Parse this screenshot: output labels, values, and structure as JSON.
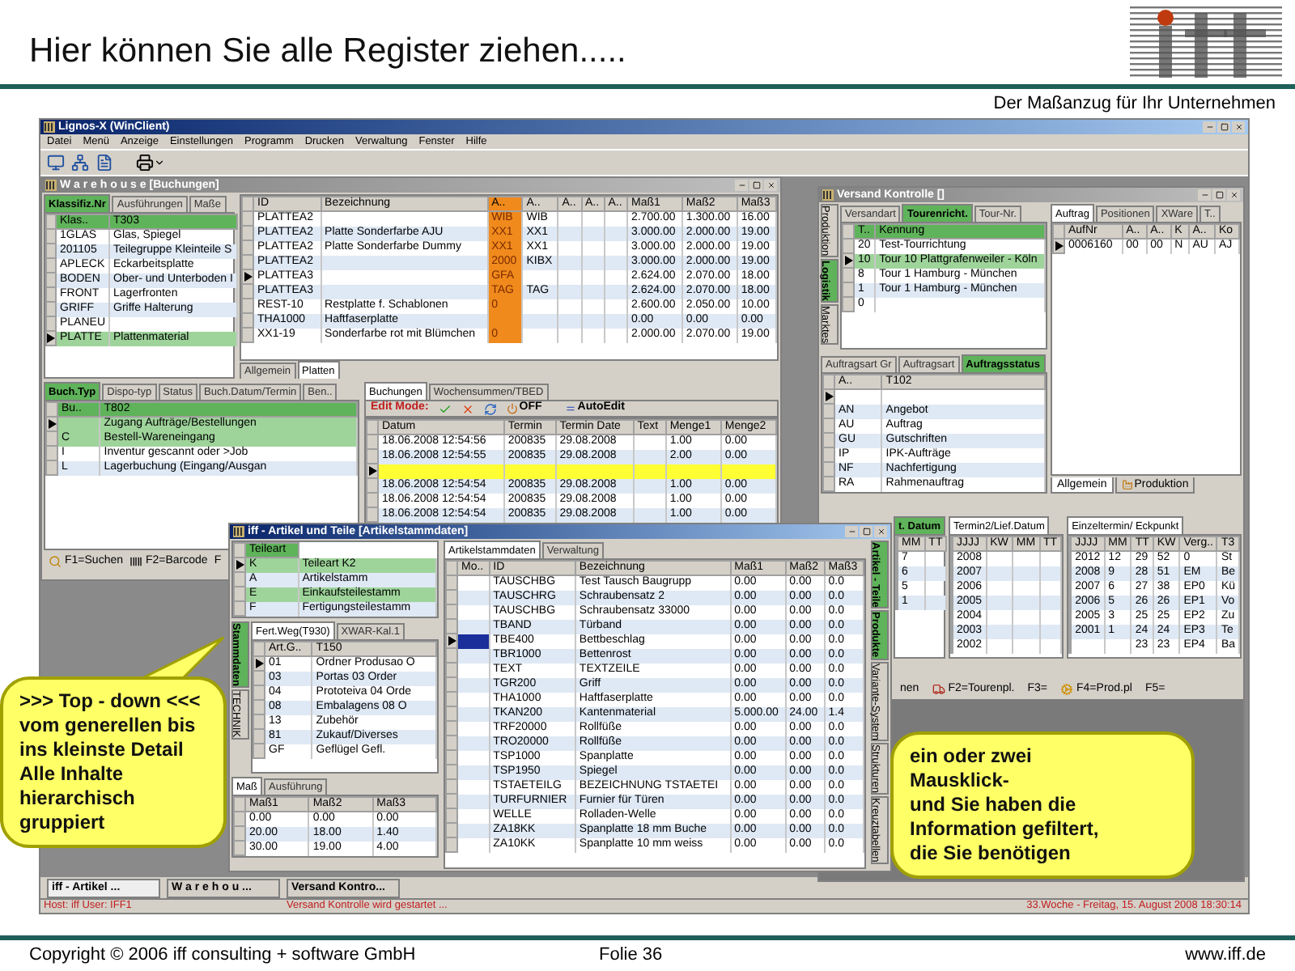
{
  "slide_title": "Hier können Sie alle Register ziehen.....",
  "tagline": "Der Maßanzug für Ihr Unternehmen",
  "app": {
    "title": "Lignos-X (WinClient)",
    "menu": [
      "Datei",
      "Menü",
      "Anzeige",
      "Einstellungen",
      "Programm",
      "Drucken",
      "Verwaltung",
      "Fenster",
      "Hilfe"
    ],
    "warehouse": {
      "title": "W a r e h o u s e [Buchungen]",
      "class_tabs": {
        "tabs": [
          {
            "label": "Klassifiz.Nr",
            "selected": true
          },
          {
            "label": "Ausführungen",
            "selected": false
          },
          {
            "label": "Maße",
            "selected": false
          }
        ]
      },
      "class_grid": {
        "header_green": true,
        "columns": [
          {
            "label": "Klas.."
          },
          {
            "label": "T303"
          }
        ],
        "rows": [
          {
            "cells": [
              "1GLAS",
              "Glas, Spiegel"
            ],
            "selected": false,
            "current": false
          },
          {
            "cells": [
              "201105",
              "Teilegruppe Kleinteile S"
            ],
            "selected": false,
            "current": false
          },
          {
            "cells": [
              "APLECK",
              "Eckarbeitsplatte"
            ],
            "selected": false,
            "current": false
          },
          {
            "cells": [
              "BODEN",
              "Ober- und Unterboden I"
            ],
            "selected": false,
            "current": false
          },
          {
            "cells": [
              "FRONT",
              "Lagerfronten"
            ],
            "selected": false,
            "current": false
          },
          {
            "cells": [
              "GRIFF",
              "Griffe Halterung"
            ],
            "selected": false,
            "current": false
          },
          {
            "cells": [
              "PLANEU",
              null
            ],
            "selected": false,
            "current": false
          },
          {
            "cells": [
              "PLATTE",
              "Plattenmaterial"
            ],
            "selected": true,
            "current": true
          }
        ]
      },
      "main_grid": {
        "header_green": false,
        "columns": [
          {
            "label": "ID",
            "accent": false
          },
          {
            "label": "Bezeichnung",
            "accent": false
          },
          {
            "label": "A..",
            "accent": true
          },
          {
            "label": "A..",
            "accent": false
          },
          {
            "label": "A..",
            "accent": false
          },
          {
            "label": "A..",
            "accent": false
          },
          {
            "label": "A..",
            "accent": false
          },
          {
            "label": "Maß1",
            "accent": false
          },
          {
            "label": "Maß2",
            "accent": false
          },
          {
            "label": "Maß3",
            "accent": false
          }
        ],
        "rows": [
          {
            "cells": [
              "PLATTEA2",
              null,
              "WIB",
              "WIB",
              null,
              null,
              null,
              "2.700.00",
              "1.300.00",
              "16.00"
            ],
            "selected": false,
            "current": false
          },
          {
            "cells": [
              "PLATTEA2",
              "Platte Sonderfarbe AJU",
              "XX1",
              "XX1",
              null,
              null,
              null,
              "3.000.00",
              "2.000.00",
              "19.00"
            ],
            "selected": false,
            "current": false
          },
          {
            "cells": [
              "PLATTEA2",
              "Platte Sonderfarbe Dummy",
              "XX1",
              "XX1",
              null,
              null,
              null,
              "3.000.00",
              "2.000.00",
              "19.00"
            ],
            "selected": false,
            "current": false
          },
          {
            "cells": [
              "PLATTEA2",
              null,
              "2000",
              "KIBX",
              null,
              null,
              null,
              "3.000.00",
              "2.000.00",
              "19.00"
            ],
            "selected": false,
            "current": false
          },
          {
            "cells": [
              "PLATTEA3",
              null,
              "GFA",
              null,
              null,
              null,
              null,
              "2.624.00",
              "2.070.00",
              "18.00"
            ],
            "selected": false,
            "current": true
          },
          {
            "cells": [
              "PLATTEA3",
              null,
              "TAG",
              "TAG",
              null,
              null,
              null,
              "2.624.00",
              "2.070.00",
              "18.00"
            ],
            "selected": false,
            "current": false
          },
          {
            "cells": [
              "REST-10",
              "Restplatte f. Schablonen",
              "0",
              null,
              null,
              null,
              null,
              "2.600.00",
              "2.050.00",
              "10.00"
            ],
            "selected": false,
            "current": false
          },
          {
            "cells": [
              "THA1000",
              "Haftfaserplatte",
              null,
              null,
              null,
              null,
              null,
              "0.00",
              "0.00",
              "0.00"
            ],
            "selected": false,
            "current": false
          },
          {
            "cells": [
              "XX1-19",
              "Sonderfarbe rot mit Blümchen",
              "0",
              null,
              null,
              null,
              null,
              "2.000.00",
              "2.070.00",
              "19.00"
            ],
            "selected": false,
            "current": false
          }
        ]
      },
      "main_tabs": {
        "tabs": [
          {
            "label": "Allgemein",
            "selected": false
          },
          {
            "label": "Platten",
            "selected": true
          }
        ]
      },
      "type_tabs": {
        "tabs": [
          {
            "label": "Buch.Typ",
            "selected": true
          },
          {
            "label": "Dispo-typ",
            "selected": false
          },
          {
            "label": "Status",
            "selected": false
          },
          {
            "label": "Buch.Datum/Termin",
            "selected": false
          },
          {
            "label": "Ben..",
            "selected": false
          }
        ]
      },
      "type_grid": {
        "header_green": true,
        "columns": [
          {
            "label": "Bu.."
          },
          {
            "label": "T802"
          }
        ],
        "rows": [
          {
            "cells": [
              null,
              "Zugang Aufträge/Bestellungen"
            ],
            "selected": true,
            "current": true
          },
          {
            "cells": [
              "C",
              "Bestell-Wareneingang"
            ],
            "selected": true,
            "current": false
          },
          {
            "cells": [
              "I",
              "Inventur gescannt oder >Job"
            ],
            "selected": false,
            "current": false
          },
          {
            "cells": [
              "L",
              "Lagerbuchung (Eingang/Ausgan"
            ],
            "selected": false,
            "current": false
          }
        ]
      },
      "booking_tabs": {
        "tabs": [
          {
            "label": "Buchungen",
            "selected": true
          },
          {
            "label": "Wochensummen/TBED",
            "selected": false
          }
        ]
      },
      "edit_mode": "Edit Mode:",
      "off_label": "OFF",
      "autoedit_label": "AutoEdit",
      "booking_grid": {
        "header_green": false,
        "columns": [
          {
            "label": "Datum"
          },
          {
            "label": "Termin"
          },
          {
            "label": "Termin Date"
          },
          {
            "label": "Text"
          },
          {
            "label": "Menge1"
          },
          {
            "label": "Menge2"
          }
        ],
        "rows": [
          {
            "cells": [
              "18.06.2008 12:54:56",
              "200835",
              "29.08.2008",
              null,
              "1.00",
              "0.00"
            ],
            "selected": false,
            "current": false,
            "editing": false
          },
          {
            "cells": [
              "18.06.2008 12:54:55",
              "200835",
              "29.08.2008",
              null,
              "2.00",
              "0.00"
            ],
            "selected": false,
            "current": false,
            "editing": false
          },
          {
            "cells": [
              null,
              null,
              null,
              null,
              null,
              null
            ],
            "selected": false,
            "current": true,
            "editing": true
          },
          {
            "cells": [
              "18.06.2008 12:54:54",
              "200835",
              "29.08.2008",
              null,
              "1.00",
              "0.00"
            ],
            "selected": false,
            "current": false,
            "editing": false
          },
          {
            "cells": [
              "18.06.2008 12:54:54",
              "200835",
              "29.08.2008",
              null,
              "1.00",
              "0.00"
            ],
            "selected": false,
            "current": false,
            "editing": false
          },
          {
            "cells": [
              "18.06.2008 12:54:54",
              "200835",
              "29.08.2008",
              null,
              "1.00",
              "0.00"
            ],
            "selected": false,
            "current": false,
            "editing": false
          }
        ]
      },
      "function_keys": [
        {
          "label": "F1=Suchen",
          "kind": "search"
        },
        {
          "label": "F2=Barcode",
          "kind": "barcode"
        },
        {
          "label": "F",
          "kind": "none"
        }
      ]
    },
    "versand": {
      "title": "Versand Kontrolle []",
      "side_tabs": [
        {
          "label": "Produktion",
          "selected": false
        },
        {
          "label": "Logistik",
          "selected": true
        },
        {
          "label": "Marktes",
          "selected": false
        }
      ],
      "tour_tabs": {
        "tabs": [
          {
            "label": "Versandart",
            "selected": false
          },
          {
            "label": "Tourenricht.",
            "selected": true
          },
          {
            "label": "Tour-Nr.",
            "selected": false
          }
        ]
      },
      "tour_grid": {
        "header_green": true,
        "columns": [
          {
            "label": "T.."
          },
          {
            "label": "Kennung"
          }
        ],
        "rows": [
          {
            "cells": [
              "20",
              "Test-Tourrichtung"
            ],
            "selected": false,
            "current": false
          },
          {
            "cells": [
              "10",
              "Tour 10 Plattgrafenweiler - Köln"
            ],
            "selected": true,
            "current": true
          },
          {
            "cells": [
              "8",
              "Tour 1 Hamburg - München"
            ],
            "selected": false,
            "current": false
          },
          {
            "cells": [
              "1",
              "Tour 1 Hamburg - München"
            ],
            "selected": false,
            "current": false
          },
          {
            "cells": [
              "0",
              null
            ],
            "selected": false,
            "current": false
          }
        ]
      },
      "order_type_tabs": {
        "tabs": [
          {
            "label": "Auftragsart Gr",
            "selected": false
          },
          {
            "label": "Auftragsart",
            "selected": false
          },
          {
            "label": "Auftragsstatus",
            "selected": true
          }
        ]
      },
      "order_type_grid": {
        "header_green": false,
        "columns": [
          {
            "label": "A.."
          },
          {
            "label": "T102"
          }
        ],
        "rows": [
          {
            "cells": [
              null,
              null
            ],
            "selected": false,
            "current": true
          },
          {
            "cells": [
              "AN",
              "Angebot"
            ],
            "selected": false,
            "current": false
          },
          {
            "cells": [
              "AU",
              "Auftrag"
            ],
            "selected": false,
            "current": false
          },
          {
            "cells": [
              "GU",
              "Gutschriften"
            ],
            "selected": false,
            "current": false
          },
          {
            "cells": [
              "IP",
              "IPK-Aufträge"
            ],
            "selected": false,
            "current": false
          },
          {
            "cells": [
              "NF",
              "Nachfertigung"
            ],
            "selected": false,
            "current": false
          },
          {
            "cells": [
              "RA",
              "Rahmenauftrag"
            ],
            "selected": false,
            "current": false
          }
        ]
      },
      "order_tabs": {
        "tabs": [
          {
            "label": "Auftrag",
            "selected": true
          },
          {
            "label": "Positionen",
            "selected": false
          },
          {
            "label": "XWare",
            "selected": false
          },
          {
            "label": "T..",
            "selected": false
          }
        ]
      },
      "order_grid": {
        "header_green": false,
        "columns": [
          {
            "label": "AufNr"
          },
          {
            "label": "A.."
          },
          {
            "label": "A.."
          },
          {
            "label": "K"
          },
          {
            "label": "A.."
          },
          {
            "label": "Ko"
          }
        ],
        "rows": [
          {
            "cells": [
              "0006160",
              "00",
              "00",
              "N",
              "AU",
              "AJ"
            ],
            "selected": false,
            "current": true
          }
        ]
      },
      "order_bottom_tabs": {
        "tabs": [
          {
            "label": "Allgemein",
            "selected": true
          },
          {
            "label": "Produktion",
            "selected": false
          }
        ]
      },
      "date1_tabs": {
        "tabs": [
          {
            "label": "t. Datum",
            "selected": true
          }
        ]
      },
      "date1_grid": {
        "header_green": false,
        "columns": [
          {
            "label": "MM"
          },
          {
            "label": "TT"
          }
        ],
        "rows": [
          {
            "cells": [
              "7",
              null
            ],
            "selected": false,
            "current": false
          },
          {
            "cells": [
              "6",
              null
            ],
            "selected": false,
            "current": false
          },
          {
            "cells": [
              "5",
              null
            ],
            "selected": false,
            "current": false
          },
          {
            "cells": [
              "1",
              null
            ],
            "selected": false,
            "current": false
          }
        ]
      },
      "date2_tabs": {
        "tabs": [
          {
            "label": "Termin2/Lief.Datum",
            "selected": true
          }
        ]
      },
      "date2_grid": {
        "header_green": false,
        "columns": [
          {
            "label": "JJJJ"
          },
          {
            "label": "KW"
          },
          {
            "label": "MM"
          },
          {
            "label": "TT"
          }
        ],
        "rows": [
          {
            "cells": [
              "2008",
              null,
              null,
              null
            ],
            "selected": false,
            "current": false
          },
          {
            "cells": [
              "2007",
              null,
              null,
              null
            ],
            "selected": false,
            "current": false
          },
          {
            "cells": [
              "2006",
              null,
              null,
              null
            ],
            "selected": false,
            "current": false
          },
          {
            "cells": [
              "2005",
              null,
              null,
              null
            ],
            "selected": false,
            "current": false
          },
          {
            "cells": [
              "2004",
              null,
              null,
              null
            ],
            "selected": false,
            "current": false
          },
          {
            "cells": [
              "2003",
              null,
              null,
              null
            ],
            "selected": false,
            "current": false
          },
          {
            "cells": [
              "2002",
              null,
              null,
              null
            ],
            "selected": false,
            "current": false
          }
        ]
      },
      "point_tabs": {
        "tabs": [
          {
            "label": "Einzeltermin/ Eckpunkt",
            "selected": true
          }
        ]
      },
      "point_grid": {
        "header_green": false,
        "columns": [
          {
            "label": "JJJJ"
          },
          {
            "label": "MM"
          },
          {
            "label": "TT"
          },
          {
            "label": "KW"
          },
          {
            "label": "Verg.."
          },
          {
            "label": "T3"
          }
        ],
        "rows": [
          {
            "cells": [
              "2012",
              "12",
              "29",
              "52",
              "0",
              "St"
            ],
            "selected": false,
            "current": false
          },
          {
            "cells": [
              "2008",
              "9",
              "28",
              "51",
              "EM",
              "Be"
            ],
            "selected": false,
            "current": false
          },
          {
            "cells": [
              "2007",
              "6",
              "27",
              "38",
              "EP0",
              "Kü"
            ],
            "selected": false,
            "current": false
          },
          {
            "cells": [
              "2006",
              "5",
              "26",
              "26",
              "EP1",
              "Vo"
            ],
            "selected": false,
            "current": false
          },
          {
            "cells": [
              "2005",
              "3",
              "25",
              "25",
              "EP2",
              "Zu"
            ],
            "selected": false,
            "current": false
          },
          {
            "cells": [
              "2001",
              "1",
              "24",
              "24",
              "EP3",
              "Te"
            ],
            "selected": false,
            "current": false
          },
          {
            "cells": [
              null,
              null,
              "23",
              "23",
              "EP4",
              "Ba"
            ],
            "selected": false,
            "current": false
          }
        ]
      },
      "function_keys": [
        {
          "label": "nen",
          "kind": "none"
        },
        {
          "label": "F2=Tourenpl.",
          "kind": "truck"
        },
        {
          "label": "F3=",
          "kind": "none"
        },
        {
          "label": "F4=Prod.pl",
          "kind": "gear"
        },
        {
          "label": "F5=",
          "kind": "none"
        }
      ]
    },
    "artikel": {
      "title": "iff - Artikel und Teile [Artikelstammdaten]",
      "part_type_grid": {
        "header_green": true,
        "columns": [
          {
            "label": "Teileart"
          }
        ],
        "rows": [
          {
            "cells": [
              "K",
              "Teileart K2"
            ],
            "selected": true,
            "current": true
          },
          {
            "cells": [
              "A",
              "Artikelstamm"
            ],
            "selected": false,
            "current": false
          },
          {
            "cells": [
              "E",
              "Einkaufsteilestamm"
            ],
            "selected": true,
            "current": false
          },
          {
            "cells": [
              "F",
              "Fertigungsteilestamm"
            ],
            "selected": false,
            "current": false
          }
        ]
      },
      "side_tabs": [
        {
          "label": "Stammdaten",
          "selected": true
        },
        {
          "label": "TECHNIK",
          "selected": false
        }
      ],
      "route_tabs": {
        "tabs": [
          {
            "label": "Fert.Weg(T930)",
            "selected": true
          },
          {
            "label": "XWAR-Kal.1",
            "selected": false
          }
        ]
      },
      "route_grid": {
        "header_green": false,
        "columns": [
          {
            "label": "Art.G.."
          },
          {
            "label": "T150"
          }
        ],
        "rows": [
          {
            "cells": [
              "01",
              "Ordner Produsao O"
            ],
            "selected": false,
            "current": true
          },
          {
            "cells": [
              "03",
              "Portas 03 Order"
            ],
            "selected": false,
            "current": false
          },
          {
            "cells": [
              "04",
              "Prototeiva 04 Orde"
            ],
            "selected": false,
            "current": false
          },
          {
            "cells": [
              "08",
              "Embalagens 08 O"
            ],
            "selected": false,
            "current": false
          },
          {
            "cells": [
              "13",
              "Zubehör"
            ],
            "selected": false,
            "current": false
          },
          {
            "cells": [
              "81",
              "Zukauf/Diverses"
            ],
            "selected": false,
            "current": false
          },
          {
            "cells": [
              "GF",
              "Geflügel Gefl."
            ],
            "selected": false,
            "current": false
          }
        ]
      },
      "size_tabs": {
        "tabs": [
          {
            "label": "Maß",
            "selected": true
          },
          {
            "label": "Ausführung",
            "selected": false
          }
        ]
      },
      "size_grid": {
        "header_green": false,
        "columns": [
          {
            "label": "Maß1"
          },
          {
            "label": "Maß2"
          },
          {
            "label": "Maß3"
          }
        ],
        "rows": [
          {
            "cells": [
              "0.00",
              "0.00",
              "0.00"
            ],
            "selected": false,
            "current": false
          },
          {
            "cells": [
              "20.00",
              "18.00",
              "1.40"
            ],
            "selected": false,
            "current": false
          },
          {
            "cells": [
              "30.00",
              "19.00",
              "4.00"
            ],
            "selected": false,
            "current": false
          }
        ]
      },
      "data_tabs": {
        "tabs": [
          {
            "label": "Artikelstammdaten",
            "selected": true
          },
          {
            "label": "Verwaltung",
            "selected": false
          }
        ]
      },
      "data_grid": {
        "header_green": false,
        "columns": [
          {
            "label": "Mo.."
          },
          {
            "label": "ID"
          },
          {
            "label": "Bezeichnung"
          },
          {
            "label": "Maß1"
          },
          {
            "label": "Maß2"
          },
          {
            "label": "Maß3"
          }
        ],
        "rows": [
          {
            "cells": [
              null,
              "TAUSCHBG",
              "Test Tausch Baugrupp",
              "0.00",
              "0.00",
              "0.0"
            ],
            "selected": false,
            "current": false
          },
          {
            "cells": [
              null,
              "TAUSCHRG",
              "Schraubensatz 2",
              "0.00",
              "0.00",
              "0.0"
            ],
            "selected": false,
            "current": false
          },
          {
            "cells": [
              null,
              "TAUSCHBG",
              "Schraubensatz 33000",
              "0.00",
              "0.00",
              "0.0"
            ],
            "selected": false,
            "current": false
          },
          {
            "cells": [
              null,
              "TBAND",
              "Türband",
              "0.00",
              "0.00",
              "0.0"
            ],
            "selected": false,
            "current": false
          },
          {
            "cells": [
              null,
              "TBE400",
              "Bettbeschlag",
              "0.00",
              "0.00",
              "0.0"
            ],
            "selected": false,
            "current": true
          },
          {
            "cells": [
              null,
              "TBR1000",
              "Bettenrost",
              "0.00",
              "0.00",
              "0.0"
            ],
            "selected": false,
            "current": false
          },
          {
            "cells": [
              null,
              "TEXT",
              "TEXTZEILE",
              "0.00",
              "0.00",
              "0.0"
            ],
            "selected": false,
            "current": false
          },
          {
            "cells": [
              null,
              "TGR200",
              "Griff",
              "0.00",
              "0.00",
              "0.0"
            ],
            "selected": false,
            "current": false
          },
          {
            "cells": [
              null,
              "THA1000",
              "Haftfaserplatte",
              "0.00",
              "0.00",
              "0.0"
            ],
            "selected": false,
            "current": false
          },
          {
            "cells": [
              null,
              "TKAN200",
              "Kantenmaterial",
              "5.000.00",
              "24.00",
              "1.4"
            ],
            "selected": false,
            "current": false
          },
          {
            "cells": [
              null,
              "TRF20000",
              "Rollfüße",
              "0.00",
              "0.00",
              "0.0"
            ],
            "selected": false,
            "current": false
          },
          {
            "cells": [
              null,
              "TRO20000",
              "Rollfüße",
              "0.00",
              "0.00",
              "0.0"
            ],
            "selected": false,
            "current": false
          },
          {
            "cells": [
              null,
              "TSP1000",
              "Spanplatte",
              "0.00",
              "0.00",
              "0.0"
            ],
            "selected": false,
            "current": false
          },
          {
            "cells": [
              null,
              "TSP1950",
              "Spiegel",
              "0.00",
              "0.00",
              "0.0"
            ],
            "selected": false,
            "current": false
          },
          {
            "cells": [
              null,
              "TSTAETEILG",
              "BEZEICHNUNG TSTAETEI",
              "0.00",
              "0.00",
              "0.0"
            ],
            "selected": false,
            "current": false
          },
          {
            "cells": [
              null,
              "TURFURNIER",
              "Furnier für Türen",
              "0.00",
              "0.00",
              "0.0"
            ],
            "selected": false,
            "current": false
          },
          {
            "cells": [
              null,
              "WELLE",
              "Rolladen-Welle",
              "0.00",
              "0.00",
              "0.0"
            ],
            "selected": false,
            "current": false
          },
          {
            "cells": [
              null,
              "ZA18KK",
              "Spanplatte 18 mm Buche",
              "0.00",
              "0.00",
              "0.0"
            ],
            "selected": false,
            "current": false
          },
          {
            "cells": [
              null,
              "ZA10KK",
              "Spanplatte 10 mm weiss",
              "0.00",
              "0.00",
              "0.0"
            ],
            "selected": false,
            "current": false
          }
        ]
      },
      "right_tabs": [
        {
          "label": "Artikel - Teile",
          "selected": true
        },
        {
          "label": "Produkte",
          "selected": true
        },
        {
          "label": "Variante-System",
          "selected": false
        },
        {
          "label": "Strukturen",
          "selected": false
        },
        {
          "label": "Kreuztabellen",
          "selected": false
        }
      ]
    },
    "taskbar": [
      {
        "label": "iff - Artikel ...",
        "selected": true
      },
      {
        "label": "W a r e h o u ...",
        "selected": false
      },
      {
        "label": "Versand Kontro...",
        "selected": false
      }
    ],
    "status": {
      "user": "Host: iff User: IFF1",
      "message": "Versand Kontrolle wird gestartet ...",
      "clock": "33.Woche - Freitag, 15. August 2008 18:30:14"
    }
  },
  "callout_left": ">>> Top - down <<<\nvom generellen bis\nins kleinste Detail\nAlle Inhalte\nhierarchisch\ngruppiert",
  "callout_right": "ein oder zwei\nMausklick-\nund Sie haben die\nInformation gefiltert,\ndie Sie benötigen",
  "footer": {
    "copyright": "Copyright © 2006 iff consulting + software GmbH",
    "slide_number": "Folie 36",
    "website": "www.iff.de"
  }
}
